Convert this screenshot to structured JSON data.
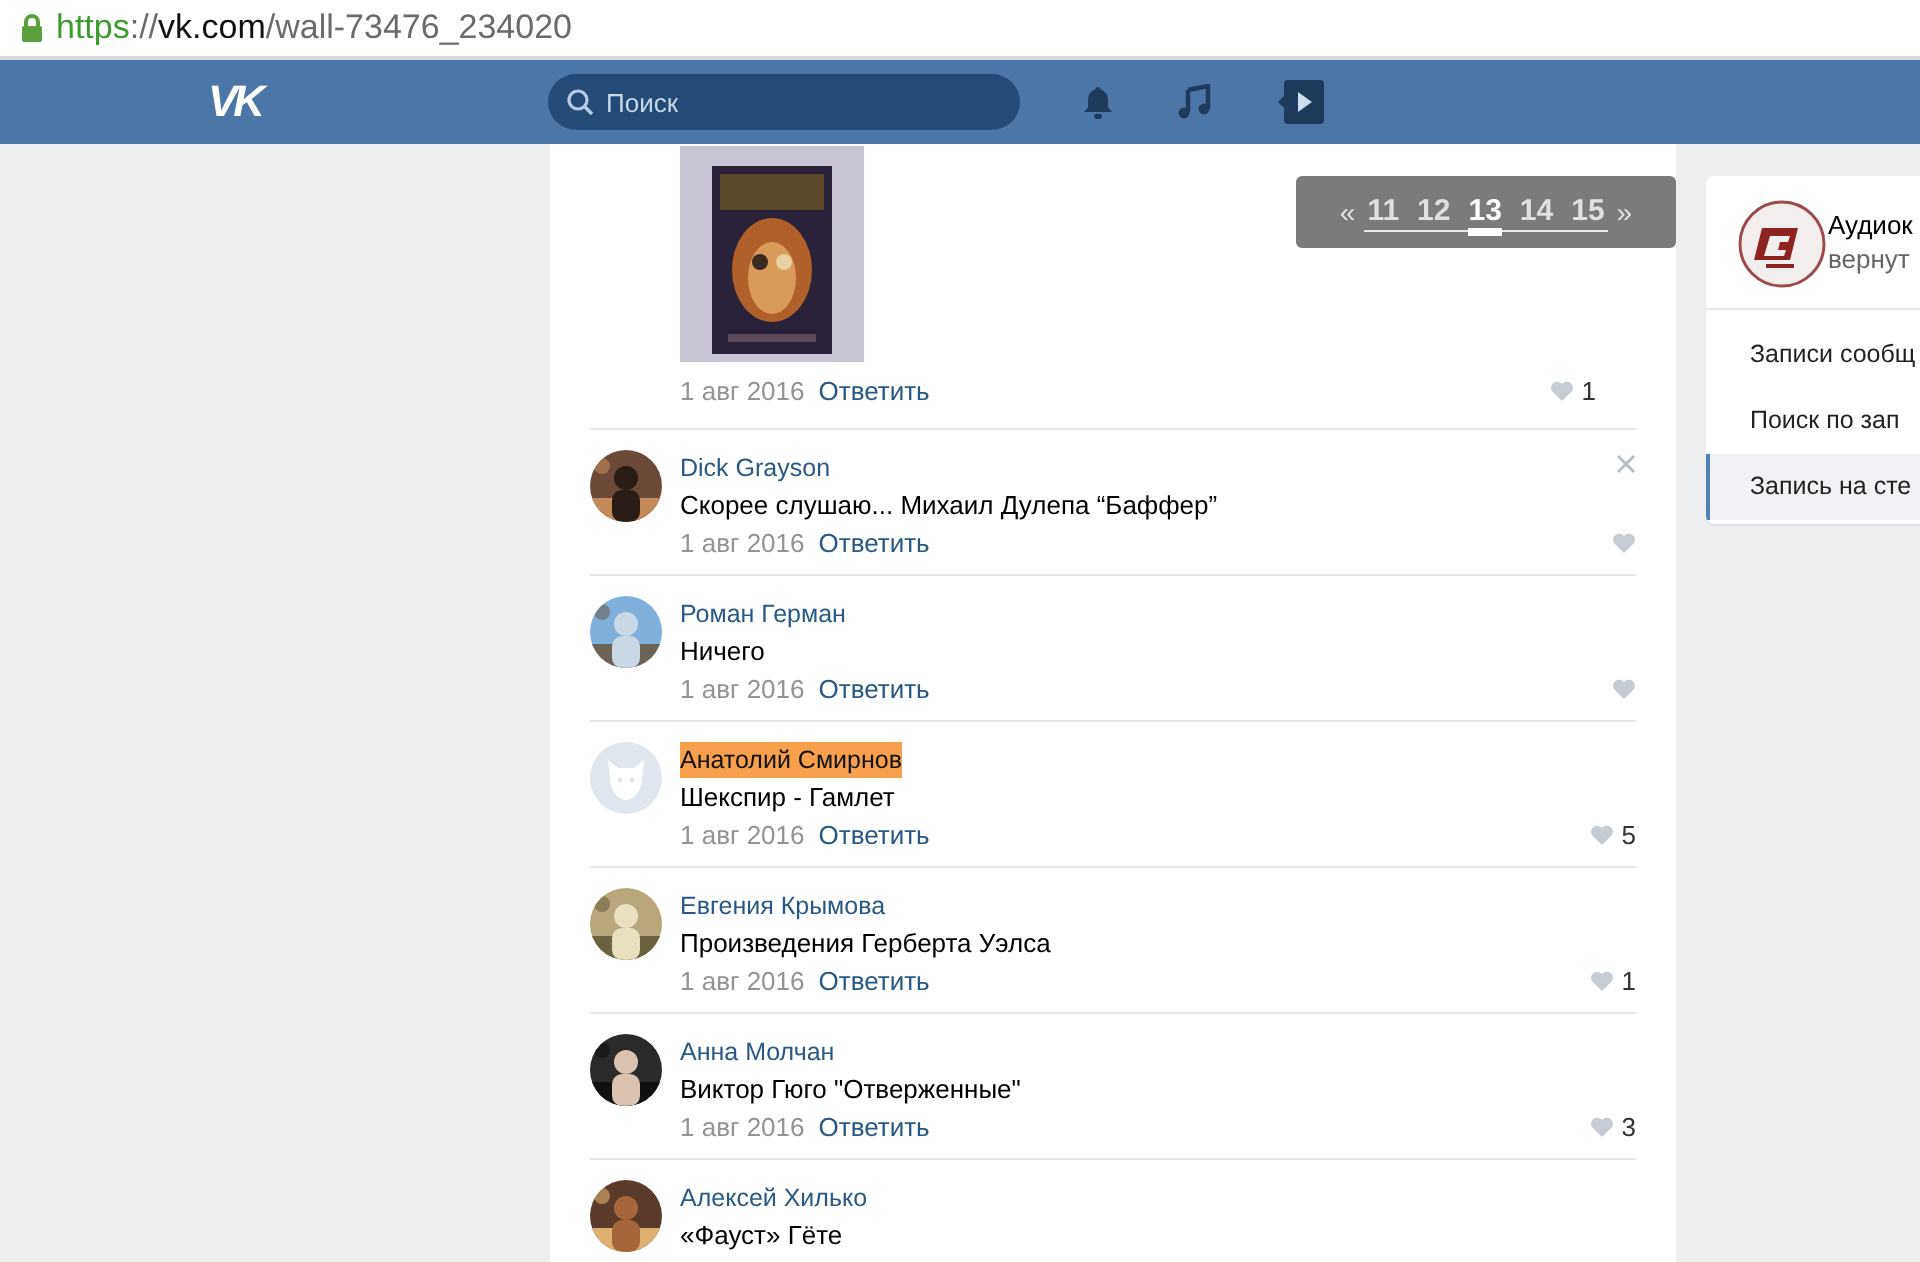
{
  "address_bar": {
    "url": [
      {
        "text": "https",
        "kind": "scheme"
      },
      {
        "text": "://",
        "kind": "plain"
      },
      {
        "text": "vk.com",
        "kind": "host"
      },
      {
        "text": "/wall-73476_234020",
        "kind": "plain"
      }
    ]
  },
  "header": {
    "logo": "VK",
    "search": {
      "placeholder": "Поиск"
    }
  },
  "post": {
    "date": "1 авг 2016",
    "reply": "Ответить",
    "likes": "1"
  },
  "comments": [
    {
      "author": "Dick Grayson",
      "highlighted": false,
      "closable": true,
      "text": "Скорее слушаю... Михаил Дулепа “Баффер”",
      "date": "1 авг 2016",
      "reply": "Ответить"
    },
    {
      "author": "Роман Герман",
      "highlighted": false,
      "closable": false,
      "text": "Ничего",
      "date": "1 авг 2016",
      "reply": "Ответить"
    },
    {
      "author": "Анатолий Смирнов",
      "highlighted": true,
      "kind": "default",
      "closable": false,
      "text": "Шекспир - Гамлет",
      "date": "1 авг 2016",
      "reply": "Ответить",
      "likes": "5"
    },
    {
      "author": "Евгения Крымова",
      "highlighted": false,
      "closable": false,
      "text": "Произведения Герберта Уэлса",
      "date": "1 авг 2016",
      "reply": "Ответить",
      "likes": "1"
    },
    {
      "author": "Анна Молчан",
      "highlighted": false,
      "closable": false,
      "text": "Виктор Гюго \"Отверженные\"",
      "date": "1 авг 2016",
      "reply": "Ответить",
      "likes": "3"
    },
    {
      "author": "Алексей Хилько",
      "highlighted": false,
      "closable": false,
      "text": "«Фауст» Гёте"
    }
  ],
  "pager": {
    "prev": "«",
    "next": "»",
    "pages": [
      {
        "label": "11",
        "selected": false
      },
      {
        "label": "12",
        "selected": false
      },
      {
        "label": "13",
        "selected": true
      },
      {
        "label": "14",
        "selected": false
      },
      {
        "label": "15",
        "selected": false
      }
    ]
  },
  "sidebar": {
    "group": {
      "title": "Аудиок",
      "subtitle": "вернут"
    },
    "menu": [
      {
        "label": "Записи сообщ",
        "selected": false
      },
      {
        "label": "Поиск по зап",
        "selected": false
      },
      {
        "label": "Запись на сте",
        "selected": true
      }
    ]
  }
}
